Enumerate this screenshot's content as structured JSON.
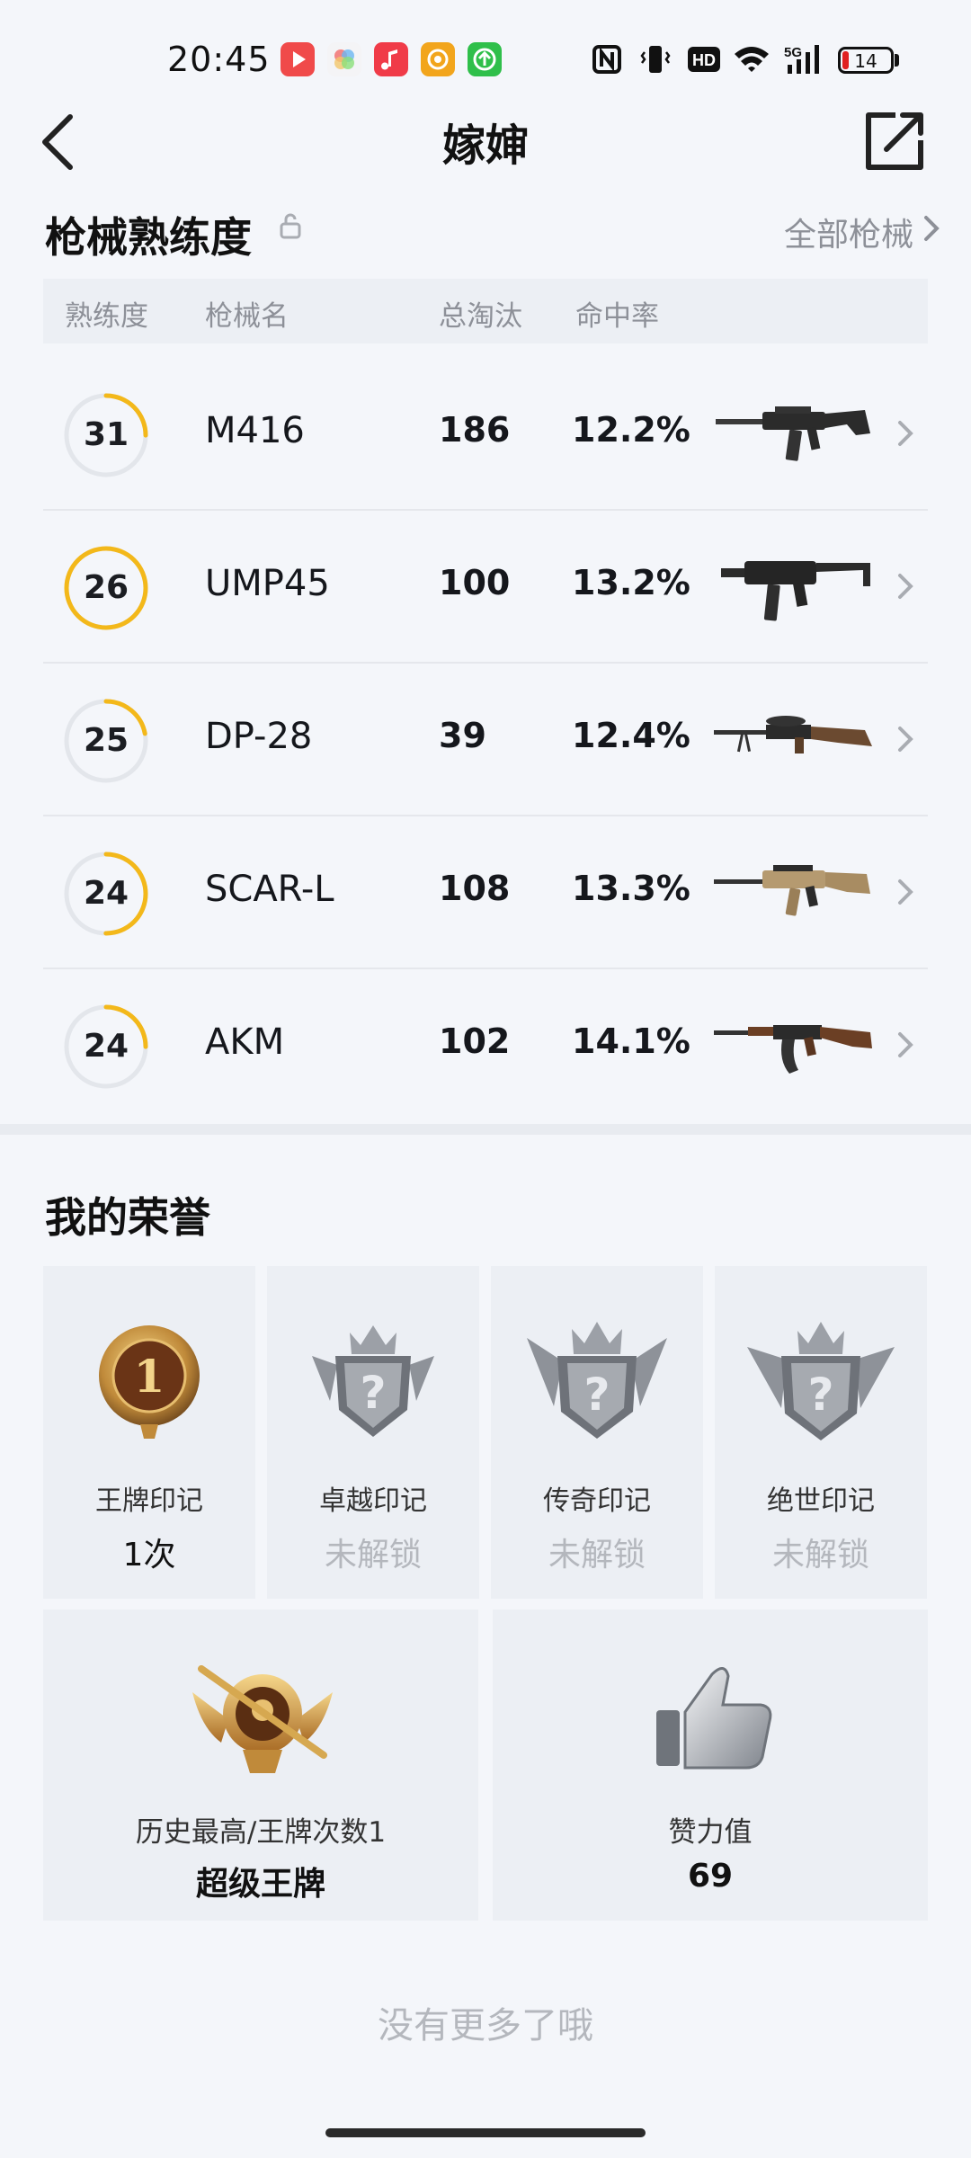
{
  "status_bar": {
    "time": "20:45",
    "battery_level": "14",
    "battery_fraction": 0.14,
    "signal_label": "5G",
    "hd_label": "HD",
    "apps": [
      {
        "icon": "video-app-icon",
        "color": "#f04a4a"
      },
      {
        "icon": "photos-app-icon",
        "color": "#f2f2f2"
      },
      {
        "icon": "music-app-icon",
        "color": "#f03b48"
      },
      {
        "icon": "reader-app-icon",
        "color": "#f2a51c"
      },
      {
        "icon": "upload-app-icon",
        "color": "#2fbf4a"
      }
    ]
  },
  "header": {
    "title": "嫁婶"
  },
  "mastery": {
    "title": "枪械熟练度",
    "all_link": "全部枪械",
    "columns": [
      "熟练度",
      "枪械名",
      "总淘汰",
      "命中率"
    ],
    "accent_color": "#f3b81a",
    "weapons": [
      {
        "level": "31",
        "progress": 0.25,
        "name": "M416",
        "kills": "186",
        "accuracy": "12.2%",
        "image": "assault-rifle-icon"
      },
      {
        "level": "26",
        "progress": 1.0,
        "name": "UMP45",
        "kills": "100",
        "accuracy": "13.2%",
        "image": "smg-icon"
      },
      {
        "level": "25",
        "progress": 0.22,
        "name": "DP-28",
        "kills": "39",
        "accuracy": "12.4%",
        "image": "lmg-icon"
      },
      {
        "level": "24",
        "progress": 0.5,
        "name": "SCAR-L",
        "kills": "108",
        "accuracy": "13.3%",
        "image": "tan-rifle-icon"
      },
      {
        "level": "24",
        "progress": 0.25,
        "name": "AKM",
        "kills": "102",
        "accuracy": "14.1%",
        "image": "akm-rifle-icon"
      }
    ]
  },
  "honors": {
    "title": "我的荣誉",
    "badges": [
      {
        "label": "王牌印记",
        "value": "1次",
        "locked": false,
        "icon": "ace-medal-icon"
      },
      {
        "label": "卓越印记",
        "value": "未解锁",
        "locked": true,
        "icon": "locked-crown-badge-icon"
      },
      {
        "label": "传奇印记",
        "value": "未解锁",
        "locked": true,
        "icon": "locked-crown-badge-icon"
      },
      {
        "label": "绝世印记",
        "value": "未解锁",
        "locked": true,
        "icon": "locked-crown-badge-icon"
      }
    ],
    "highlights": [
      {
        "label": "历史最高/王牌次数1",
        "value": "超级王牌",
        "icon": "super-ace-emblem-icon"
      },
      {
        "label": "赞力值",
        "value": "69",
        "icon": "thumbs-up-icon"
      }
    ]
  },
  "footer": {
    "text": "没有更多了哦"
  }
}
